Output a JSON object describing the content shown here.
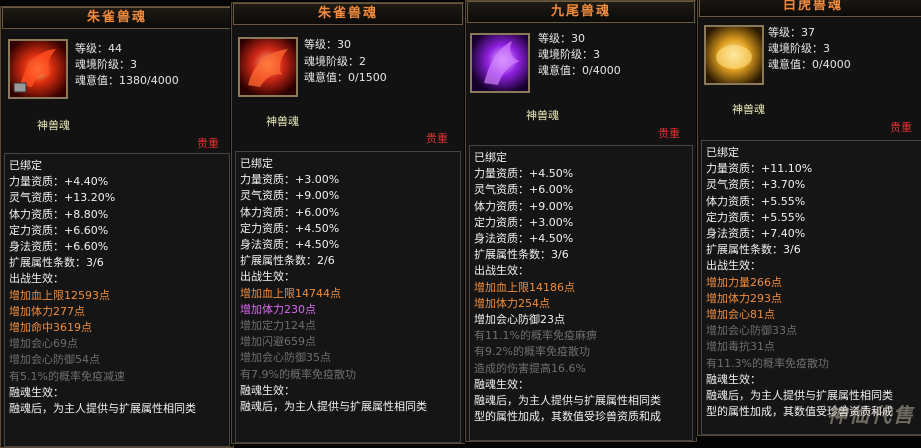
{
  "cards": [
    {
      "title": "朱雀兽魂",
      "level": "等级：44",
      "realm": "魂境阶级：3",
      "spirit": "魂意值：1380/4000",
      "type": "神兽魂",
      "rarity": "贵重",
      "bound": "已绑定",
      "aptitudes": [
        "力量资质：+4.40%",
        "灵气资质：+13.20%",
        "体力资质：+8.80%",
        "定力资质：+6.60%",
        "身法资质：+6.60%"
      ],
      "ext_count": "扩展属性条数：3/6",
      "battle_label": "出战生效：",
      "effects": [
        {
          "text": "增加血上限12593点",
          "style": "o"
        },
        {
          "text": "增加体力277点",
          "style": "o"
        },
        {
          "text": "增加命中3619点",
          "style": "o"
        },
        {
          "text": "增加会心69点",
          "style": "g"
        },
        {
          "text": "增加会心防御54点",
          "style": "g"
        },
        {
          "text": "有5.1%的概率免疫减速",
          "style": "g"
        }
      ],
      "fusion_label": "融魂生效：",
      "fusion_text": "融魂后，为主人提供与扩展属性相同类"
    },
    {
      "title": "朱雀兽魂",
      "level": "等级：30",
      "realm": "魂境阶级：2",
      "spirit": "魂意值：0/1500",
      "type": "神兽魂",
      "rarity": "贵重",
      "bound": "已绑定",
      "aptitudes": [
        "力量资质：+3.00%",
        "灵气资质：+9.00%",
        "体力资质：+6.00%",
        "定力资质：+4.50%",
        "身法资质：+4.50%"
      ],
      "ext_count": "扩展属性条数：2/6",
      "battle_label": "出战生效：",
      "effects": [
        {
          "text": "增加血上限14744点",
          "style": "o"
        },
        {
          "text": "增加体力230点",
          "style": "p"
        },
        {
          "text": "增加定力124点",
          "style": "g"
        },
        {
          "text": "增加闪避659点",
          "style": "g"
        },
        {
          "text": "增加会心防御35点",
          "style": "g"
        },
        {
          "text": "有7.9%的概率免疫散功",
          "style": "g"
        }
      ],
      "fusion_label": "融魂生效：",
      "fusion_text": "融魂后，为主人提供与扩展属性相同类"
    },
    {
      "title": "九尾兽魂",
      "level": "等级：30",
      "realm": "魂境阶级：3",
      "spirit": "魂意值：0/4000",
      "type": "神兽魂",
      "rarity": "贵重",
      "bound": "已绑定",
      "aptitudes": [
        "力量资质：+4.50%",
        "灵气资质：+6.00%",
        "体力资质：+9.00%",
        "定力资质：+3.00%",
        "身法资质：+4.50%"
      ],
      "ext_count": "扩展属性条数：3/6",
      "battle_label": "出战生效：",
      "effects": [
        {
          "text": "增加血上限14186点",
          "style": "o"
        },
        {
          "text": "增加体力254点",
          "style": "o"
        },
        {
          "text": "增加会心防御23点",
          "style": "w"
        },
        {
          "text": "有11.1%的概率免疫麻痹",
          "style": "g"
        },
        {
          "text": "有9.2%的概率免疫散功",
          "style": "g"
        },
        {
          "text": "造成的伤害提高16.6%",
          "style": "g"
        }
      ],
      "fusion_label": "融魂生效：",
      "fusion_text": "融魂后，为主人提供与扩展属性相同类",
      "fusion_text2": "型的属性加成，其数值受珍兽资质和成"
    },
    {
      "title": "白虎兽魂",
      "level": "等级：37",
      "realm": "魂境阶级：3",
      "spirit": "魂意值：0/4000",
      "type": "神兽魂",
      "rarity": "贵重",
      "bound": "已绑定",
      "aptitudes": [
        "力量资质：+11.10%",
        "灵气资质：+3.70%",
        "体力资质：+5.55%",
        "定力资质：+5.55%",
        "身法资质：+7.40%"
      ],
      "ext_count": "扩展属性条数：3/6",
      "battle_label": "出战生效：",
      "effects": [
        {
          "text": "增加力量266点",
          "style": "o"
        },
        {
          "text": "增加体力293点",
          "style": "o"
        },
        {
          "text": "增加会心81点",
          "style": "o"
        },
        {
          "text": "增加会心防御33点",
          "style": "g"
        },
        {
          "text": "增加毒抗31点",
          "style": "g"
        },
        {
          "text": "有11.3%的概率免疫散功",
          "style": "g"
        }
      ],
      "fusion_label": "融魂生效：",
      "fusion_text": "融魂后，为主人提供与扩展属性相同类",
      "fusion_text2": "型的属性加成，其数值受珍兽资质和成"
    }
  ],
  "watermark": "神仙代售"
}
